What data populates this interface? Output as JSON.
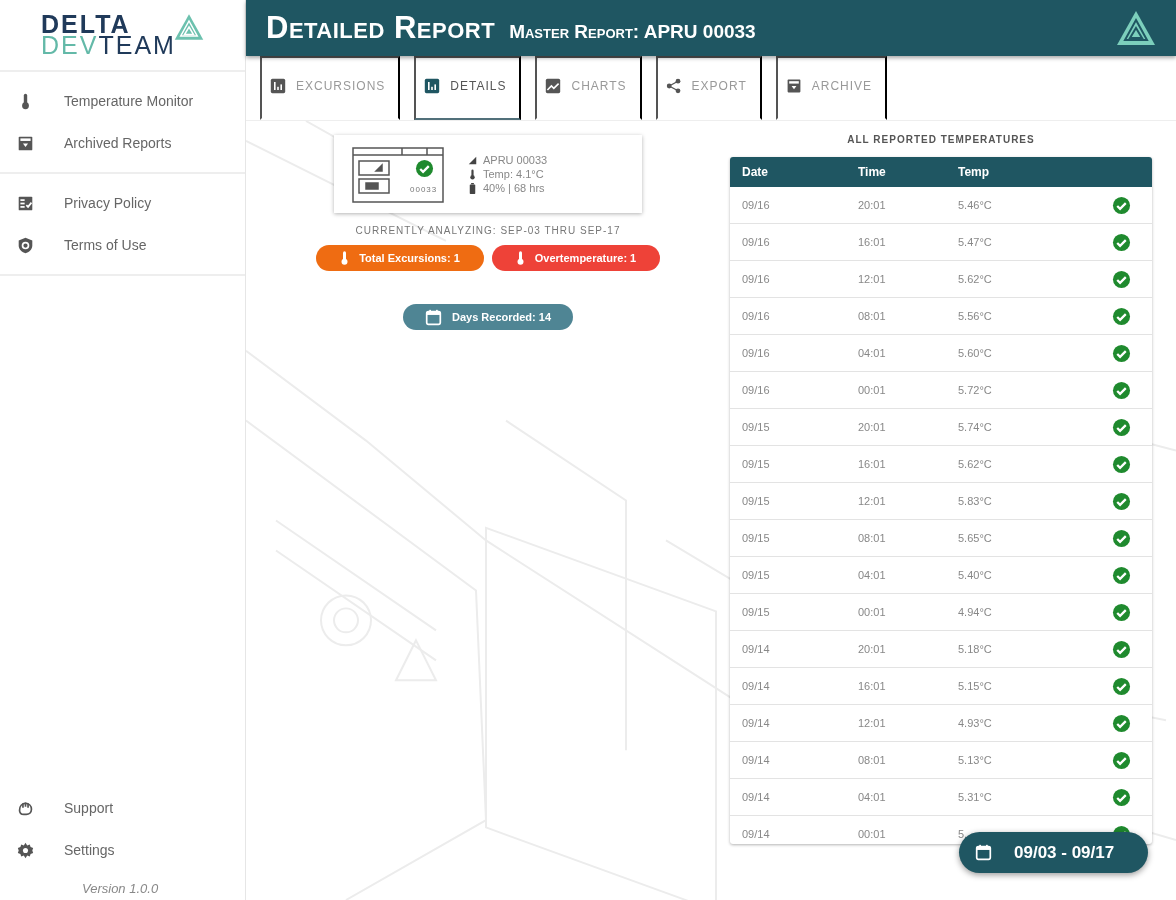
{
  "sidebar": {
    "logo": {
      "line1": "DELTA",
      "line2_accent": "DEV",
      "line2_rest": "TEAM"
    },
    "groups": [
      [
        {
          "label": "Temperature Monitor"
        },
        {
          "label": "Archived Reports"
        }
      ],
      [
        {
          "label": "Privacy Policy"
        },
        {
          "label": "Terms of Use"
        }
      ]
    ],
    "bottom_items": [
      {
        "label": "Support"
      },
      {
        "label": "Settings"
      }
    ],
    "version": "Version 1.0.0"
  },
  "header": {
    "title": "Detailed Report",
    "subtitle": "Master Report: APRU 00033"
  },
  "tabs": [
    {
      "label": "EXCURSIONS",
      "selected": false
    },
    {
      "label": "DETAILS",
      "selected": true
    },
    {
      "label": "CHARTS",
      "selected": false
    },
    {
      "label": "EXPORT",
      "selected": false
    },
    {
      "label": "ARCHIVE",
      "selected": false
    }
  ],
  "device_card": {
    "device_label": "00033",
    "status_ok": true,
    "lines": [
      "APRU 00033",
      "Temp: 4.1°C",
      "40% | 68 hrs"
    ]
  },
  "analyzing": "CURRENTLY ANALYZING: SEP-03 THRU SEP-17",
  "pills": [
    {
      "label": "Total Excursions: 1",
      "color": "#ef6c12"
    },
    {
      "label": "Overtemperature: 1",
      "color": "#ee4238"
    }
  ],
  "days_pill": {
    "label": "Days Recorded: 14",
    "color": "#4f8594"
  },
  "table": {
    "title": "ALL REPORTED TEMPERATURES",
    "columns": [
      "Date",
      "Time",
      "Temp"
    ],
    "rows": [
      {
        "date": "09/16",
        "time": "20:01",
        "temp": "5.46°C",
        "ok": true
      },
      {
        "date": "09/16",
        "time": "16:01",
        "temp": "5.47°C",
        "ok": true
      },
      {
        "date": "09/16",
        "time": "12:01",
        "temp": "5.62°C",
        "ok": true
      },
      {
        "date": "09/16",
        "time": "08:01",
        "temp": "5.56°C",
        "ok": true
      },
      {
        "date": "09/16",
        "time": "04:01",
        "temp": "5.60°C",
        "ok": true
      },
      {
        "date": "09/16",
        "time": "00:01",
        "temp": "5.72°C",
        "ok": true
      },
      {
        "date": "09/15",
        "time": "20:01",
        "temp": "5.74°C",
        "ok": true
      },
      {
        "date": "09/15",
        "time": "16:01",
        "temp": "5.62°C",
        "ok": true
      },
      {
        "date": "09/15",
        "time": "12:01",
        "temp": "5.83°C",
        "ok": true
      },
      {
        "date": "09/15",
        "time": "08:01",
        "temp": "5.65°C",
        "ok": true
      },
      {
        "date": "09/15",
        "time": "04:01",
        "temp": "5.40°C",
        "ok": true
      },
      {
        "date": "09/15",
        "time": "00:01",
        "temp": "4.94°C",
        "ok": true
      },
      {
        "date": "09/14",
        "time": "20:01",
        "temp": "5.18°C",
        "ok": true
      },
      {
        "date": "09/14",
        "time": "16:01",
        "temp": "5.15°C",
        "ok": true
      },
      {
        "date": "09/14",
        "time": "12:01",
        "temp": "4.93°C",
        "ok": true
      },
      {
        "date": "09/14",
        "time": "08:01",
        "temp": "5.13°C",
        "ok": true
      },
      {
        "date": "09/14",
        "time": "04:01",
        "temp": "5.31°C",
        "ok": true
      },
      {
        "date": "09/14",
        "time": "00:01",
        "temp": "5.",
        "ok": true
      }
    ]
  },
  "date_range_button": {
    "label": "09/03 - 09/17"
  }
}
